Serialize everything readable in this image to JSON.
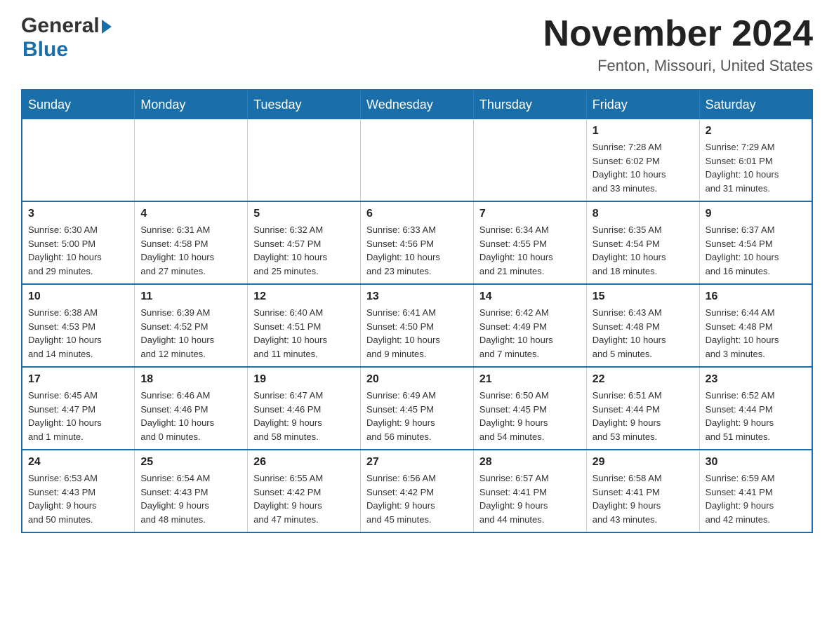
{
  "header": {
    "logo_general": "General",
    "logo_blue": "Blue",
    "month_title": "November 2024",
    "location": "Fenton, Missouri, United States"
  },
  "calendar": {
    "days_of_week": [
      "Sunday",
      "Monday",
      "Tuesday",
      "Wednesday",
      "Thursday",
      "Friday",
      "Saturday"
    ],
    "weeks": [
      {
        "days": [
          {
            "number": "",
            "info": ""
          },
          {
            "number": "",
            "info": ""
          },
          {
            "number": "",
            "info": ""
          },
          {
            "number": "",
            "info": ""
          },
          {
            "number": "",
            "info": ""
          },
          {
            "number": "1",
            "info": "Sunrise: 7:28 AM\nSunset: 6:02 PM\nDaylight: 10 hours\nand 33 minutes."
          },
          {
            "number": "2",
            "info": "Sunrise: 7:29 AM\nSunset: 6:01 PM\nDaylight: 10 hours\nand 31 minutes."
          }
        ]
      },
      {
        "days": [
          {
            "number": "3",
            "info": "Sunrise: 6:30 AM\nSunset: 5:00 PM\nDaylight: 10 hours\nand 29 minutes."
          },
          {
            "number": "4",
            "info": "Sunrise: 6:31 AM\nSunset: 4:58 PM\nDaylight: 10 hours\nand 27 minutes."
          },
          {
            "number": "5",
            "info": "Sunrise: 6:32 AM\nSunset: 4:57 PM\nDaylight: 10 hours\nand 25 minutes."
          },
          {
            "number": "6",
            "info": "Sunrise: 6:33 AM\nSunset: 4:56 PM\nDaylight: 10 hours\nand 23 minutes."
          },
          {
            "number": "7",
            "info": "Sunrise: 6:34 AM\nSunset: 4:55 PM\nDaylight: 10 hours\nand 21 minutes."
          },
          {
            "number": "8",
            "info": "Sunrise: 6:35 AM\nSunset: 4:54 PM\nDaylight: 10 hours\nand 18 minutes."
          },
          {
            "number": "9",
            "info": "Sunrise: 6:37 AM\nSunset: 4:54 PM\nDaylight: 10 hours\nand 16 minutes."
          }
        ]
      },
      {
        "days": [
          {
            "number": "10",
            "info": "Sunrise: 6:38 AM\nSunset: 4:53 PM\nDaylight: 10 hours\nand 14 minutes."
          },
          {
            "number": "11",
            "info": "Sunrise: 6:39 AM\nSunset: 4:52 PM\nDaylight: 10 hours\nand 12 minutes."
          },
          {
            "number": "12",
            "info": "Sunrise: 6:40 AM\nSunset: 4:51 PM\nDaylight: 10 hours\nand 11 minutes."
          },
          {
            "number": "13",
            "info": "Sunrise: 6:41 AM\nSunset: 4:50 PM\nDaylight: 10 hours\nand 9 minutes."
          },
          {
            "number": "14",
            "info": "Sunrise: 6:42 AM\nSunset: 4:49 PM\nDaylight: 10 hours\nand 7 minutes."
          },
          {
            "number": "15",
            "info": "Sunrise: 6:43 AM\nSunset: 4:48 PM\nDaylight: 10 hours\nand 5 minutes."
          },
          {
            "number": "16",
            "info": "Sunrise: 6:44 AM\nSunset: 4:48 PM\nDaylight: 10 hours\nand 3 minutes."
          }
        ]
      },
      {
        "days": [
          {
            "number": "17",
            "info": "Sunrise: 6:45 AM\nSunset: 4:47 PM\nDaylight: 10 hours\nand 1 minute."
          },
          {
            "number": "18",
            "info": "Sunrise: 6:46 AM\nSunset: 4:46 PM\nDaylight: 10 hours\nand 0 minutes."
          },
          {
            "number": "19",
            "info": "Sunrise: 6:47 AM\nSunset: 4:46 PM\nDaylight: 9 hours\nand 58 minutes."
          },
          {
            "number": "20",
            "info": "Sunrise: 6:49 AM\nSunset: 4:45 PM\nDaylight: 9 hours\nand 56 minutes."
          },
          {
            "number": "21",
            "info": "Sunrise: 6:50 AM\nSunset: 4:45 PM\nDaylight: 9 hours\nand 54 minutes."
          },
          {
            "number": "22",
            "info": "Sunrise: 6:51 AM\nSunset: 4:44 PM\nDaylight: 9 hours\nand 53 minutes."
          },
          {
            "number": "23",
            "info": "Sunrise: 6:52 AM\nSunset: 4:44 PM\nDaylight: 9 hours\nand 51 minutes."
          }
        ]
      },
      {
        "days": [
          {
            "number": "24",
            "info": "Sunrise: 6:53 AM\nSunset: 4:43 PM\nDaylight: 9 hours\nand 50 minutes."
          },
          {
            "number": "25",
            "info": "Sunrise: 6:54 AM\nSunset: 4:43 PM\nDaylight: 9 hours\nand 48 minutes."
          },
          {
            "number": "26",
            "info": "Sunrise: 6:55 AM\nSunset: 4:42 PM\nDaylight: 9 hours\nand 47 minutes."
          },
          {
            "number": "27",
            "info": "Sunrise: 6:56 AM\nSunset: 4:42 PM\nDaylight: 9 hours\nand 45 minutes."
          },
          {
            "number": "28",
            "info": "Sunrise: 6:57 AM\nSunset: 4:41 PM\nDaylight: 9 hours\nand 44 minutes."
          },
          {
            "number": "29",
            "info": "Sunrise: 6:58 AM\nSunset: 4:41 PM\nDaylight: 9 hours\nand 43 minutes."
          },
          {
            "number": "30",
            "info": "Sunrise: 6:59 AM\nSunset: 4:41 PM\nDaylight: 9 hours\nand 42 minutes."
          }
        ]
      }
    ]
  }
}
